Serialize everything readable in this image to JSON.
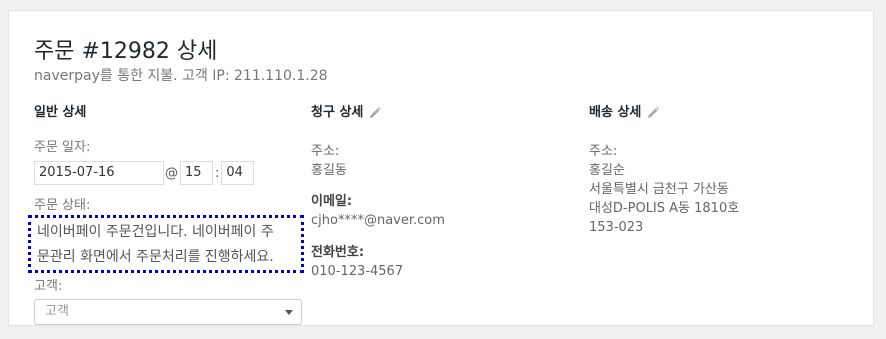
{
  "header": {
    "title": "주문 #12982 상세",
    "subtitle": "naverpay를 통한 지불. 고객 IP: 211.110.1.28"
  },
  "general": {
    "heading": "일반 상세",
    "date_label": "주문 일자:",
    "date_value": "2015-07-16",
    "at": "@",
    "hour": "15",
    "colon": ":",
    "minute": "04",
    "status_label": "주문 상태:",
    "status_line1": "네이버페이 주문건입니다. 네이버페이 주",
    "status_line2": "문관리 화면에서 주문처리를 진행하세요.",
    "customer_label": "고객:",
    "customer_placeholder": "고객"
  },
  "billing": {
    "heading": "청구 상세",
    "edit_icon": "pencil-icon",
    "address_label": "주소:",
    "address_name": "홍길동",
    "email_label": "이메일:",
    "email_value": "cjho****@naver.com",
    "phone_label": "전화번호:",
    "phone_value": "010-123-4567"
  },
  "shipping": {
    "heading": "배송 상세",
    "edit_icon": "pencil-icon",
    "address_label": "주소:",
    "address_lines": [
      "홍길순",
      "서울특별시 금천구 가산동",
      "대성D-POLIS A동 1810호",
      "153-023"
    ]
  },
  "colors": {
    "background": "#f1f1f1",
    "panel": "#ffffff",
    "highlight_border": "#0000cc"
  }
}
